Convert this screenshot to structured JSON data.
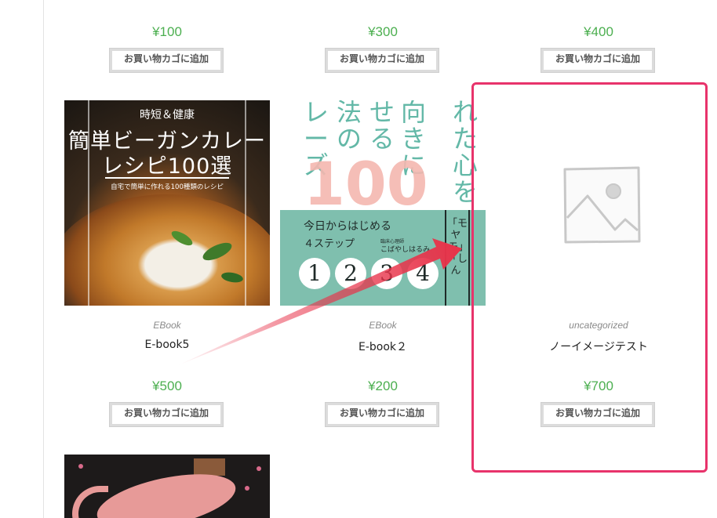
{
  "row1": {
    "products": [
      {
        "price": "¥100",
        "button": "お買い物カゴに追加"
      },
      {
        "price": "¥300",
        "button": "お買い物カゴに追加"
      },
      {
        "price": "¥400",
        "button": "お買い物カゴに追加"
      }
    ]
  },
  "row2": {
    "products": [
      {
        "category": "EBook",
        "title": "E-book5",
        "price": "¥500",
        "button": "お買い物カゴに追加",
        "cover": {
          "small": "時短＆健康",
          "line1": "簡単ビーガンカレー",
          "line2": "レシピ100選",
          "sub": "自宅で簡単に作れる100種類のレシピ"
        }
      },
      {
        "category": "EBook",
        "title": "E-book２",
        "price": "¥200",
        "button": "お買い物カゴに追加",
        "cover": {
          "columns": [
            "れた心を",
            "向きに",
            "せる",
            "法の",
            "レーズ"
          ],
          "hundred": "100",
          "today": "今日からはじめる",
          "steps": "４ステップ",
          "author_small": "臨床心理師",
          "author": "こばやしはるみ",
          "numbers": [
            "1",
            "2",
            "3",
            "4"
          ],
          "right": "「モヤモ」「しん"
        }
      },
      {
        "category": "uncategorized",
        "title": "ノーイメージテスト",
        "price": "¥700",
        "button": "お買い物カゴに追加"
      }
    ]
  },
  "colors": {
    "price": "#4caf50",
    "highlight": "#e8336b",
    "arrow": "#e8334a"
  }
}
